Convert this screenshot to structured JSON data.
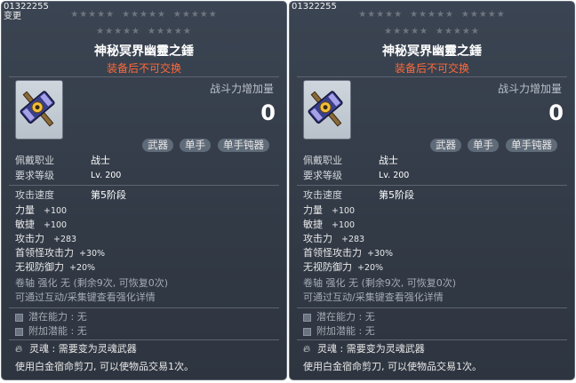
{
  "panels": [
    {
      "id_text": "01322255",
      "sub_text": "变更",
      "stars": {
        "row1": [
          "★★★★★",
          "★★★★★",
          "★★★★★"
        ],
        "row2": [
          "★★★★★",
          "★★★★★"
        ]
      },
      "title": "神秘冥界幽靈之錘",
      "untradeable": "装备后不可交换",
      "combat_power_label": "战斗力增加量",
      "combat_power_value": "0",
      "tags": [
        "武器",
        "单手",
        "单手钝器"
      ],
      "job_label": "佩戴职业",
      "job_value": "战士",
      "level_label": "要求等级",
      "level_value": "Lv. 200",
      "speed_label": "攻击速度",
      "speed_value": "第5阶段",
      "stats": [
        {
          "label": "力量",
          "value": "+100"
        },
        {
          "label": "敏捷",
          "value": "+100"
        },
        {
          "label": "攻击力",
          "value": "+283"
        },
        {
          "label": "首领怪攻击力",
          "value": "+30%"
        },
        {
          "label": "无视防御力",
          "value": "+20%"
        }
      ],
      "scroll_line": "卷轴 强化 无 (剩余9次, 可恢复0次)",
      "enhance_hint": "可通过互动/采集键查看强化详情",
      "potential": "潜在能力 : 无",
      "bonus_potential": "附加潜能 : 无",
      "soul": "灵魂 : 需要变为灵魂武器",
      "footer": "使用白金宿命剪刀, 可以使物品交易1次。"
    },
    {
      "id_text": "01322255",
      "sub_text": "",
      "stars": {
        "row1": [
          "★★★★★",
          "★★★★★",
          "★★★★★"
        ],
        "row2": [
          "★★★★★",
          "★★★★★"
        ]
      },
      "title": "神秘冥界幽靈之錘",
      "untradeable": "装备后不可交换",
      "combat_power_label": "战斗力增加量",
      "combat_power_value": "0",
      "tags": [
        "武器",
        "单手",
        "单手钝器"
      ],
      "job_label": "佩戴职业",
      "job_value": "战士",
      "level_label": "要求等级",
      "level_value": "Lv. 200",
      "speed_label": "攻击速度",
      "speed_value": "第5阶段",
      "stats": [
        {
          "label": "力量",
          "value": "+100"
        },
        {
          "label": "敏捷",
          "value": "+100"
        },
        {
          "label": "攻击力",
          "value": "+283"
        },
        {
          "label": "首领怪攻击力",
          "value": "+30%"
        },
        {
          "label": "无视防御力",
          "value": "+20%"
        }
      ],
      "scroll_line": "卷轴 强化 无 (剩余9次, 可恢复0次)",
      "enhance_hint": "可通过互动/采集键查看强化详情",
      "potential": "潜在能力 : 无",
      "bonus_potential": "附加潜能 : 无",
      "soul": "灵魂 : 需要变为灵魂武器",
      "footer": "使用白金宿命剪刀, 可以使物品交易1次。"
    }
  ]
}
